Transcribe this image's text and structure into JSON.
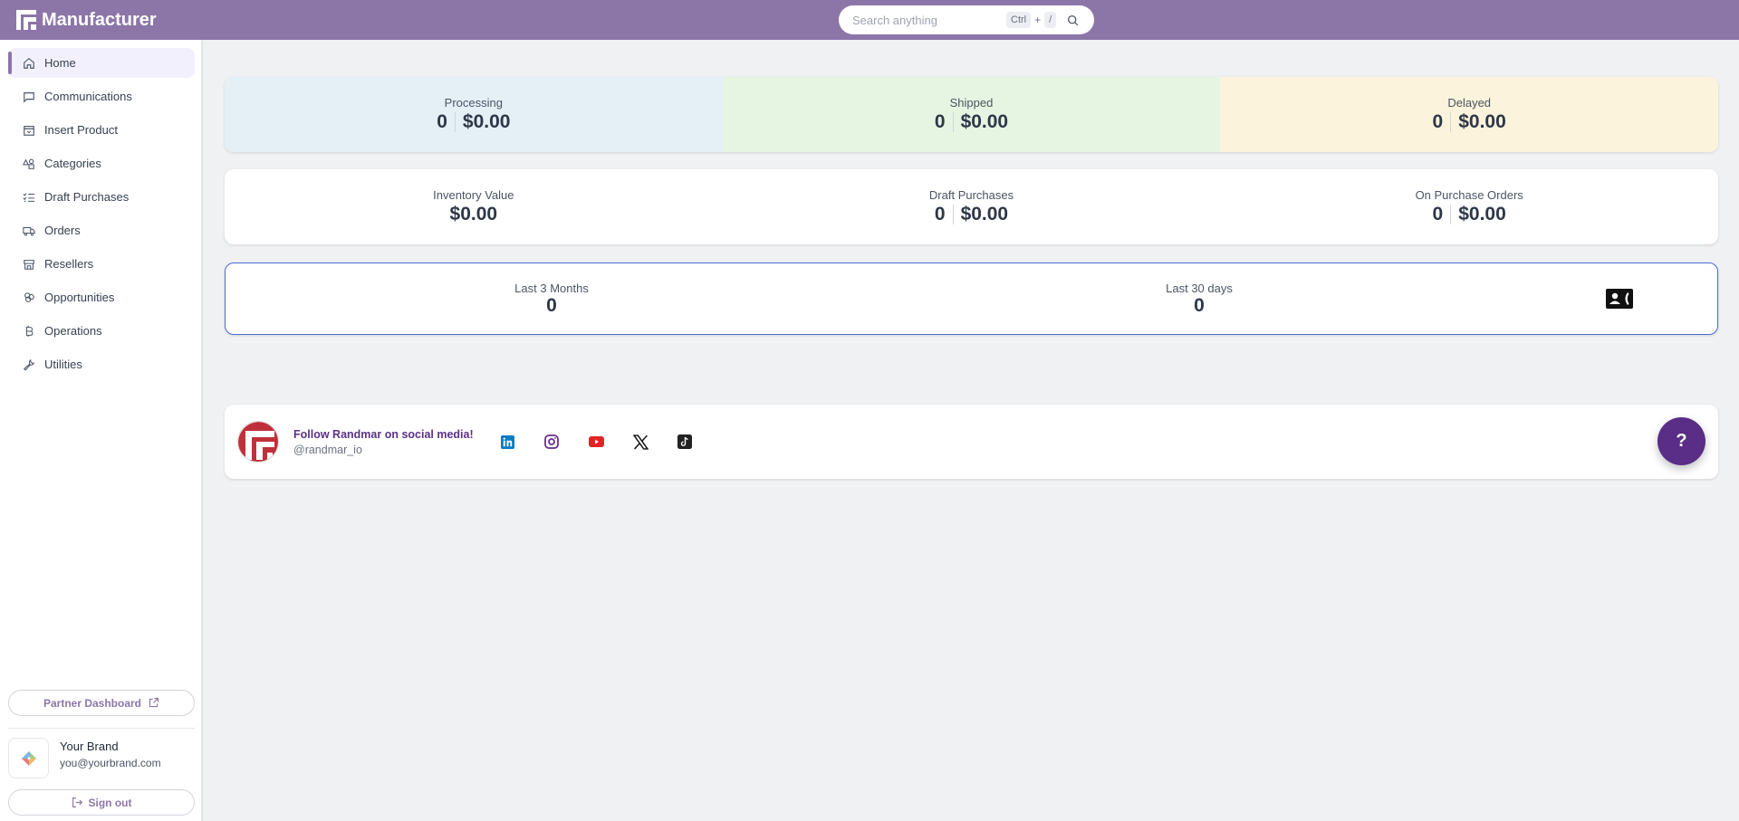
{
  "app": {
    "title": "Manufacturer"
  },
  "search": {
    "placeholder": "Search anything",
    "shortcut_key1": "Ctrl",
    "shortcut_plus": "+",
    "shortcut_key2": "/"
  },
  "sidebar": {
    "items": [
      {
        "label": "Home",
        "icon": "home-icon",
        "active": true
      },
      {
        "label": "Communications",
        "icon": "message-icon"
      },
      {
        "label": "Insert Product",
        "icon": "archive-icon"
      },
      {
        "label": "Categories",
        "icon": "shapes-icon"
      },
      {
        "label": "Draft Purchases",
        "icon": "list-checks-icon"
      },
      {
        "label": "Orders",
        "icon": "truck-icon"
      },
      {
        "label": "Resellers",
        "icon": "store-icon"
      },
      {
        "label": "Opportunities",
        "icon": "clover-icon"
      },
      {
        "label": "Operations",
        "icon": "bitcoin-icon"
      },
      {
        "label": "Utilities",
        "icon": "wrench-icon"
      }
    ],
    "partner_dashboard": "Partner Dashboard",
    "user": {
      "name": "Your Brand",
      "email": "you@yourbrand.com"
    },
    "sign_out": "Sign out"
  },
  "status_cards": [
    {
      "label": "Processing",
      "count": "0",
      "amount": "$0.00",
      "bg": "#e4eff6"
    },
    {
      "label": "Shipped",
      "count": "0",
      "amount": "$0.00",
      "bg": "#e6f5e2"
    },
    {
      "label": "Delayed",
      "count": "0",
      "amount": "$0.00",
      "bg": "#fcf3dc"
    }
  ],
  "summary": {
    "inventory": {
      "label": "Inventory Value",
      "amount": "$0.00"
    },
    "draft": {
      "label": "Draft Purchases",
      "count": "0",
      "amount": "$0.00"
    },
    "purchase_orders": {
      "label": "On Purchase Orders",
      "count": "0",
      "amount": "$0.00"
    }
  },
  "periods": {
    "three_months": {
      "label": "Last 3 Months",
      "value": "0"
    },
    "thirty_days": {
      "label": "Last 30 days",
      "value": "0"
    }
  },
  "social": {
    "title": "Follow Randmar on social media!",
    "handle": "@randmar_io",
    "networks": [
      "linkedin",
      "instagram",
      "youtube",
      "x",
      "tiktok"
    ]
  },
  "help": {
    "label": "?"
  },
  "colors": {
    "topbar": "#8c76a8",
    "accent": "#5a2d86",
    "border_highlight": "#4a6bd1"
  }
}
